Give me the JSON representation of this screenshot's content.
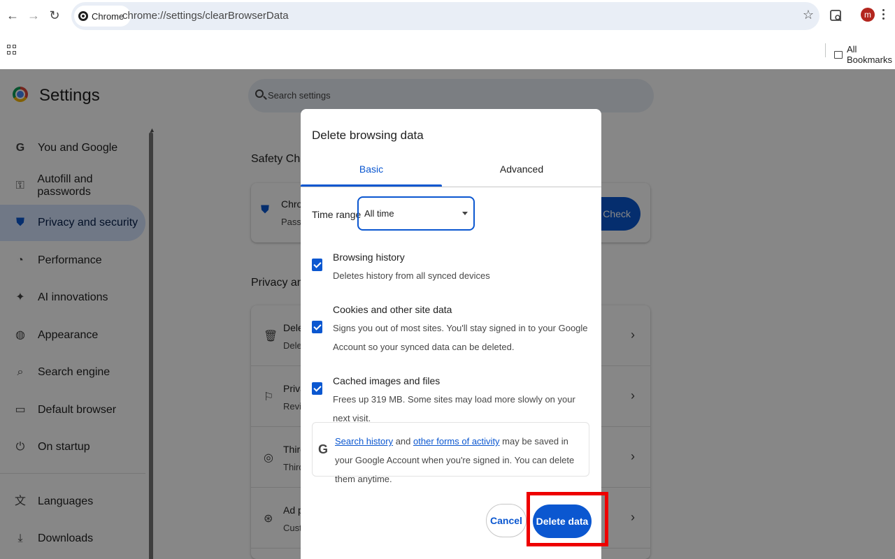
{
  "browser": {
    "chip_label": "Chrome",
    "url": "chrome://settings/clearBrowserData",
    "avatar_letter": "m",
    "bookmarks_label": "All Bookmarks"
  },
  "settings": {
    "title": "Settings",
    "search_placeholder": "Search settings",
    "sidebar": [
      {
        "label": "You and Google",
        "icon": "google-icon"
      },
      {
        "label": "Autofill and passwords",
        "icon": "key-icon"
      },
      {
        "label": "Privacy and security",
        "icon": "shield-icon",
        "active": true
      },
      {
        "label": "Performance",
        "icon": "speedometer-icon"
      },
      {
        "label": "AI innovations",
        "icon": "sparkle-icon"
      },
      {
        "label": "Appearance",
        "icon": "palette-icon"
      },
      {
        "label": "Search engine",
        "icon": "search-icon"
      },
      {
        "label": "Default browser",
        "icon": "browser-icon"
      },
      {
        "label": "On startup",
        "icon": "power-icon"
      },
      {
        "label": "Languages",
        "icon": "translate-icon"
      },
      {
        "label": "Downloads",
        "icon": "download-icon"
      }
    ],
    "safety_check": {
      "section_title": "Safety Check",
      "row_title": "Chrom",
      "row_sub": "Passw",
      "button": "ty Check"
    },
    "privacy": {
      "section_title": "Privacy and s",
      "rows": [
        {
          "title": "Delet",
          "sub": "Delet"
        },
        {
          "title": "Priva",
          "sub": "Revie"
        },
        {
          "title": "Third",
          "sub": "Third"
        },
        {
          "title": "Ad p",
          "sub": "Custo"
        }
      ]
    }
  },
  "dialog": {
    "title": "Delete browsing data",
    "tabs": {
      "basic": "Basic",
      "advanced": "Advanced"
    },
    "time_range": {
      "label": "Time range",
      "value": "All time"
    },
    "options": [
      {
        "title": "Browsing history",
        "desc": "Deletes history from all synced devices",
        "checked": true
      },
      {
        "title": "Cookies and other site data",
        "desc": "Signs you out of most sites. You'll stay signed in to your Google Account so your synced data can be deleted.",
        "checked": true
      },
      {
        "title": "Cached images and files",
        "desc": "Frees up 319 MB. Some sites may load more slowly on your next visit.",
        "checked": true
      }
    ],
    "info": {
      "link1": "Search history",
      "and": " and ",
      "link2": "other forms of activity",
      "rest": " may be saved in your Google Account when you're signed in. You can delete them anytime."
    },
    "cancel": "Cancel",
    "delete": "Delete data"
  },
  "colors": {
    "accent": "#0b57d0",
    "highlight": "#ee0000"
  }
}
